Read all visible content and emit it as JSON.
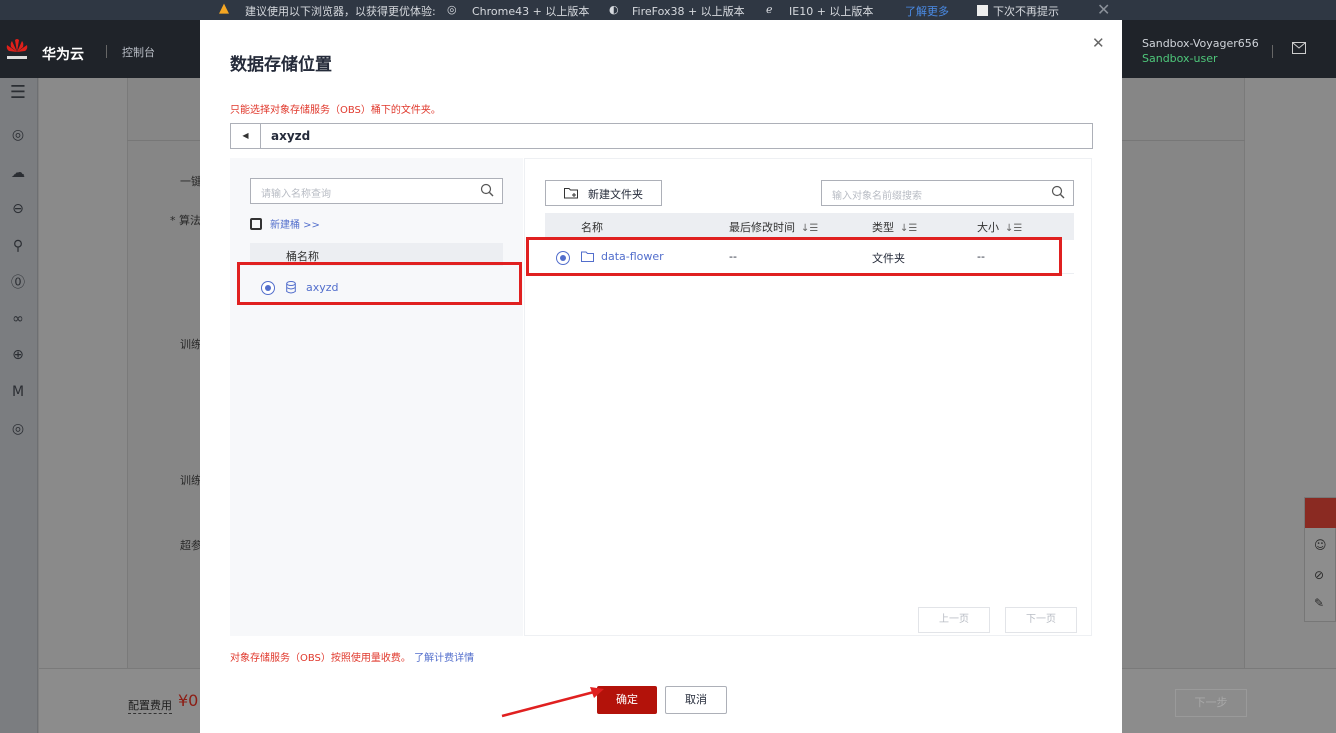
{
  "tipbar": {
    "message": "建议使用以下浏览器，以获得更优体验:",
    "chrome": "Chrome43 + 以上版本",
    "firefox": "FireFox38 + 以上版本",
    "ie": "IE10 + 以上版本",
    "learn_more": "了解更多",
    "dont_show": "下次不再提示"
  },
  "header": {
    "brand": "华为云",
    "console": "控制台",
    "user_name": "Sandbox-Voyager656",
    "user_role": "Sandbox-user"
  },
  "background": {
    "labels": [
      "一键",
      "* 算法",
      "训练",
      "训练",
      "超参"
    ],
    "fee_label": "配置费用",
    "fee_value": "¥0",
    "next_button": "下一步"
  },
  "dialog": {
    "title": "数据存储位置",
    "hint": "只能选择对象存储服务（OBS）桶下的文件夹。",
    "current_path": "axyzd",
    "bucket_search_placeholder": "请输入名称查询",
    "new_bucket": "新建桶 >>",
    "bucket_column": "桶名称",
    "buckets": [
      {
        "name": "axyzd",
        "selected": true
      }
    ],
    "new_folder": "新建文件夹",
    "object_search_placeholder": "输入对象名前缀搜索",
    "columns": {
      "name": "名称",
      "modified": "最后修改时间",
      "type": "类型",
      "size": "大小"
    },
    "objects": [
      {
        "name": "data-flower",
        "modified": "--",
        "type": "文件夹",
        "size": "--",
        "selected": true
      }
    ],
    "prev_page": "上一页",
    "next_page": "下一页",
    "billing_note": "对象存储服务（OBS）按照使用量收费。",
    "billing_link": "了解计费详情",
    "ok": "确定",
    "cancel": "取消"
  },
  "colors": {
    "brand_red": "#b3120a",
    "link_blue": "#526ecc",
    "highlight": "#e02020",
    "warn_text": "#e0382c"
  }
}
